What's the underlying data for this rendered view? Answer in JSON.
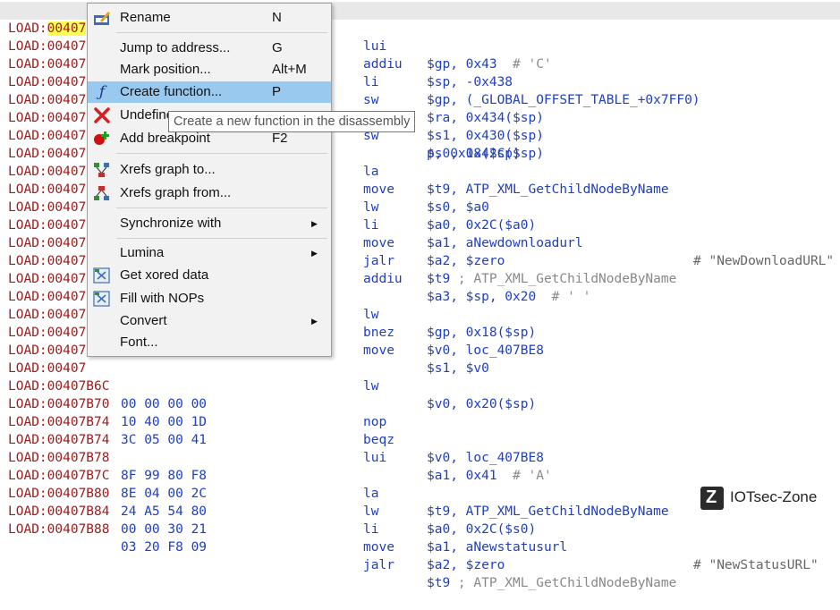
{
  "listing": {
    "rows": [
      {
        "addr": "LOAD:",
        "off": "00407",
        "bytes": "",
        "mn": "lui",
        "ops": "$gp, 0x43",
        "cmt": "  # 'C'",
        "rcmt": ""
      },
      {
        "addr": "LOAD:",
        "off": "00407",
        "bytes": "",
        "mn": "addiu",
        "ops": "$sp, -0x438",
        "cmt": "",
        "rcmt": ""
      },
      {
        "addr": "LOAD:",
        "off": "00407",
        "bytes": "",
        "mn": "li",
        "ops": "$gp, (_GLOBAL_OFFSET_TABLE_+0x7FF0)",
        "cmt": "",
        "rcmt": ""
      },
      {
        "addr": "LOAD:",
        "off": "00407",
        "bytes": "",
        "mn": "sw",
        "ops": "$ra, 0x434($sp)",
        "cmt": "",
        "rcmt": ""
      },
      {
        "addr": "LOAD:",
        "off": "00407",
        "bytes": "",
        "mn": "sw",
        "ops": "$s1, 0x430($sp)",
        "cmt": "",
        "rcmt": ""
      },
      {
        "addr": "LOAD:",
        "off": "00407",
        "bytes": "",
        "mn": "sw",
        "ops": "$s0, 0x42C($sp)",
        "cmt": "",
        "rcmt": ""
      },
      {
        "addr": "LOAD:",
        "off": "00407",
        "bytes": "",
        "mn": "",
        "ops": "p, 0x18($sp)",
        "cmt": "",
        "rcmt": ""
      },
      {
        "addr": "LOAD:",
        "off": "00407",
        "bytes": "",
        "mn": "la",
        "ops": "$t9, ATP_XML_GetChildNodeByName",
        "cmt": "",
        "rcmt": ""
      },
      {
        "addr": "LOAD:",
        "off": "00407",
        "bytes": "",
        "mn": "move",
        "ops": "$s0, $a0",
        "cmt": "",
        "rcmt": ""
      },
      {
        "addr": "LOAD:",
        "off": "00407",
        "bytes": "",
        "mn": "lw",
        "ops": "$a0, 0x2C($a0)",
        "cmt": "",
        "rcmt": ""
      },
      {
        "addr": "LOAD:",
        "off": "00407",
        "bytes": "",
        "mn": "li",
        "ops": "$a1, aNewdownloadurl",
        "cmt": "",
        "rcmt": "# \"NewDownloadURL\""
      },
      {
        "addr": "LOAD:",
        "off": "00407",
        "bytes": "",
        "mn": "move",
        "ops": "$a2, $zero",
        "cmt": "",
        "rcmt": ""
      },
      {
        "addr": "LOAD:",
        "off": "00407",
        "bytes": "",
        "mn": "jalr",
        "ops": "$t9 ",
        "cmt": "; ATP_XML_GetChildNodeByName",
        "rcmt": ""
      },
      {
        "addr": "LOAD:",
        "off": "00407",
        "bytes": "",
        "mn": "addiu",
        "ops": "$a3, $sp, 0x20",
        "cmt": "  # ' '",
        "rcmt": ""
      },
      {
        "addr": "LOAD:",
        "off": "00407",
        "bytes": "",
        "mn": "",
        "ops": "",
        "cmt": "",
        "rcmt": ""
      },
      {
        "addr": "LOAD:",
        "off": "00407",
        "bytes": "",
        "mn": "lw",
        "ops": "$gp, 0x18($sp)",
        "cmt": "",
        "rcmt": ""
      },
      {
        "addr": "LOAD:",
        "off": "00407",
        "bytes": "",
        "mn": "bnez",
        "ops": "$v0, loc_407BE8",
        "cmt": "",
        "rcmt": ""
      },
      {
        "addr": "LOAD:",
        "off": "00407",
        "bytes": "",
        "mn": "move",
        "ops": "$s1, $v0",
        "cmt": "",
        "rcmt": ""
      },
      {
        "addr": "LOAD:",
        "off": "00407",
        "bytes": "",
        "mn": "",
        "ops": "",
        "cmt": "",
        "rcmt": ""
      },
      {
        "addr": "LOAD:",
        "off": "00407",
        "bytes": "",
        "mn": "lw",
        "ops": "$v0, 0x20($sp)",
        "cmt": "",
        "rcmt": ""
      },
      {
        "addr": "LOAD:",
        "off": "00407B6C",
        "bytes": "00 00 00 00",
        "mn": "nop",
        "ops": "",
        "cmt": "",
        "rcmt": ""
      },
      {
        "addr": "LOAD:",
        "off": "00407B70",
        "bytes": "10 40 00 1D",
        "mn": "beqz",
        "ops": "$v0, loc_407BE8",
        "cmt": "",
        "rcmt": ""
      },
      {
        "addr": "LOAD:",
        "off": "00407B74",
        "bytes": "3C 05 00 41",
        "mn": "lui",
        "ops": "$a1, 0x41",
        "cmt": "  # 'A'",
        "rcmt": ""
      },
      {
        "addr": "LOAD:",
        "off": "00407B74",
        "bytes": "",
        "mn": "",
        "ops": "",
        "cmt": "",
        "rcmt": ""
      },
      {
        "addr": "LOAD:",
        "off": "00407B78",
        "bytes": "8F 99 80 F8",
        "mn": "la",
        "ops": "$t9, ATP_XML_GetChildNodeByName",
        "cmt": "",
        "rcmt": ""
      },
      {
        "addr": "LOAD:",
        "off": "00407B7C",
        "bytes": "8E 04 00 2C",
        "mn": "lw",
        "ops": "$a0, 0x2C($s0)",
        "cmt": "",
        "rcmt": ""
      },
      {
        "addr": "LOAD:",
        "off": "00407B80",
        "bytes": "24 A5 54 80",
        "mn": "li",
        "ops": "$a1, aNewstatusurl",
        "cmt": "",
        "rcmt": "# \"NewStatusURL\""
      },
      {
        "addr": "LOAD:",
        "off": "00407B84",
        "bytes": "00 00 30 21",
        "mn": "move",
        "ops": "$a2, $zero",
        "cmt": "",
        "rcmt": ""
      },
      {
        "addr": "LOAD:",
        "off": "00407B88",
        "bytes": "03 20 F8 09",
        "mn": "jalr",
        "ops": "$t9 ",
        "cmt": "; ATP_XML_GetChildNodeByName",
        "rcmt": ""
      }
    ]
  },
  "menu": {
    "items": [
      {
        "label": "Rename",
        "shortcut": "N",
        "icon": "rename-icon",
        "submenu": false
      },
      {
        "label": "Jump to address...",
        "shortcut": "G",
        "icon": "",
        "submenu": false
      },
      {
        "label": "Mark position...",
        "shortcut": "Alt+M",
        "icon": "",
        "submenu": false
      },
      {
        "label": "Create function...",
        "shortcut": "P",
        "icon": "function-icon",
        "submenu": false
      },
      {
        "label": "Undefine",
        "shortcut": "",
        "icon": "undefine-x-icon",
        "submenu": false
      },
      {
        "label": "Add breakpoint",
        "shortcut": "F2",
        "icon": "breakpoint-icon",
        "submenu": false
      },
      {
        "label": "Xrefs graph to...",
        "shortcut": "",
        "icon": "xrefs-graph-to-icon",
        "submenu": false
      },
      {
        "label": "Xrefs graph from...",
        "shortcut": "",
        "icon": "xrefs-graph-from-icon",
        "submenu": false
      },
      {
        "label": "Synchronize with",
        "shortcut": "",
        "icon": "",
        "submenu": true
      },
      {
        "label": "Lumina",
        "shortcut": "",
        "icon": "",
        "submenu": true
      },
      {
        "label": "Get xored data",
        "shortcut": "",
        "icon": "plugin-icon",
        "submenu": false
      },
      {
        "label": "Fill with NOPs",
        "shortcut": "",
        "icon": "plugin-icon",
        "submenu": false
      },
      {
        "label": "Convert",
        "shortcut": "",
        "icon": "",
        "submenu": true
      },
      {
        "label": "Font...",
        "shortcut": "",
        "icon": "",
        "submenu": false
      }
    ],
    "arrow_glyph": "▶"
  },
  "tooltip": {
    "text": "Create a new function in the disassembly"
  },
  "watermark": {
    "text": "IOTsec-Zone",
    "logo_letter": "Z"
  },
  "colors": {
    "address": "#9b1c1c",
    "code": "#1f3fbf",
    "highlight": "#99c9ef",
    "comment": "#888888"
  }
}
